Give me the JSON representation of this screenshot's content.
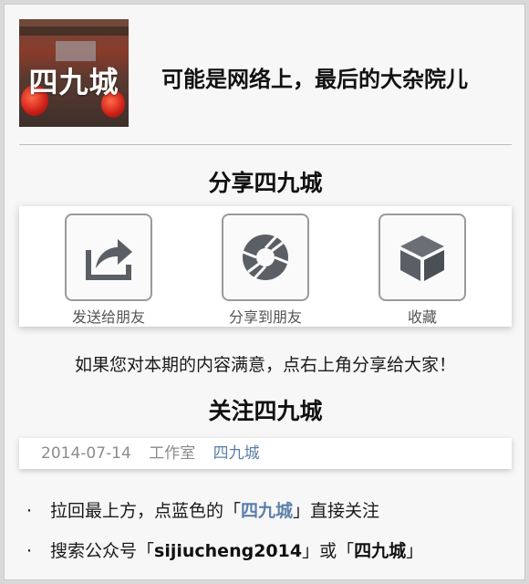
{
  "header": {
    "logo_text": "四九城",
    "slogan": "可能是网络上，最后的大杂院儿"
  },
  "share": {
    "title": "分享四九城",
    "buttons": [
      {
        "label": "发送给朋友",
        "icon": "share-arrow-icon"
      },
      {
        "label": "分享到朋友",
        "icon": "aperture-icon"
      },
      {
        "label": "收藏",
        "icon": "cube-icon"
      }
    ],
    "tip": "如果您对本期的内容满意，点右上角分享给大家！"
  },
  "follow": {
    "title": "关注四九城",
    "meta": {
      "date": "2014-07-14",
      "studio": "工作室",
      "account": "四九城"
    },
    "bullets": [
      {
        "bullet": "·",
        "prefix": "拉回最上方，点蓝色的「",
        "highlight": "四九城",
        "suffix": "」直接关注"
      },
      {
        "bullet": "·",
        "prefix": "搜索公众号「",
        "highlight": "sijiucheng2014",
        "middle": "」或「",
        "highlight2": "四九城",
        "suffix": "」"
      }
    ]
  },
  "colors": {
    "link_blue": "#5b7faa",
    "page_bg": "#f7f7f7"
  }
}
